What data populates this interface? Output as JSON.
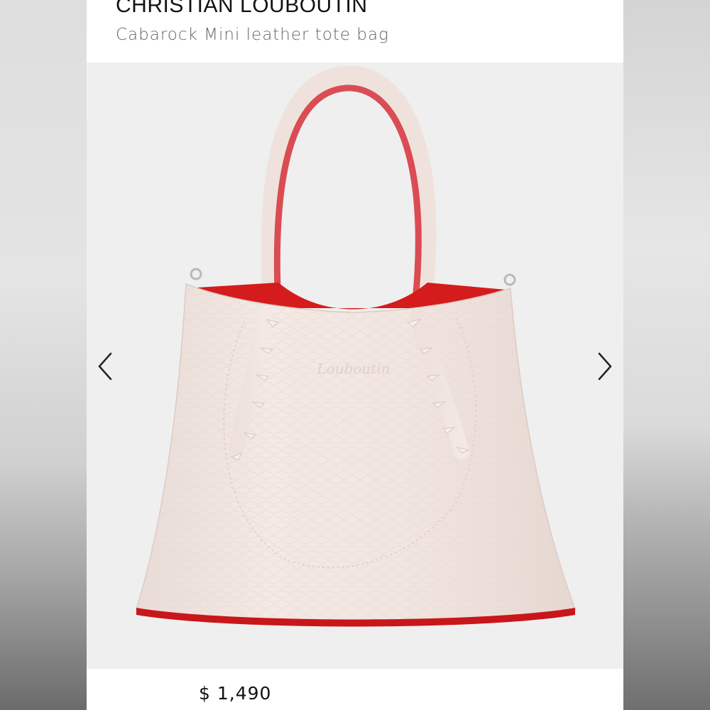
{
  "product": {
    "brand": "CHRISTIAN LOUBOUTIN",
    "name": "Cabarock Mini leather tote bag",
    "price": "$ 1,490",
    "image_icon": "product-photo-icon"
  },
  "gallery": {
    "prev_icon": "chevron-left-icon",
    "next_icon": "chevron-right-icon"
  },
  "colors": {
    "card_background": "#ffffff",
    "image_background": "#efefef",
    "bag_body": "#f1e4df",
    "bag_lining": "#d81e1e",
    "text_primary": "#111111",
    "text_secondary": "#666666"
  }
}
